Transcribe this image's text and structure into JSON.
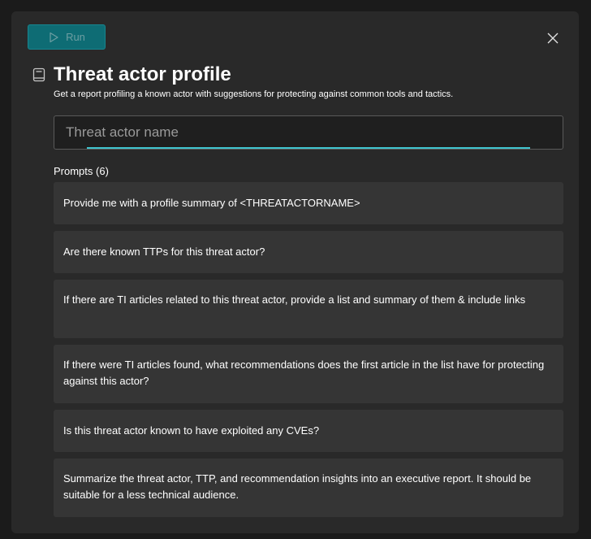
{
  "toolbar": {
    "run_label": "Run",
    "run_icon": "play-icon",
    "close_icon": "close-icon"
  },
  "header": {
    "icon": "book-icon",
    "title": "Threat actor profile",
    "subtitle": "Get a report profiling a known actor with suggestions for protecting against common tools and tactics."
  },
  "input": {
    "placeholder": "Threat actor name",
    "value": ""
  },
  "prompts": {
    "label": "Prompts (6)",
    "items": [
      {
        "text": "Provide me with a profile summary of <THREATACTORNAME>"
      },
      {
        "text": "Are there known TTPs for this threat actor?"
      },
      {
        "text": "If there are TI articles related to this threat actor, provide a list and summary of them & include links"
      },
      {
        "text": "If there were TI articles found, what recommendations does the first article in the list have for protecting against this actor?"
      },
      {
        "text": "Is this threat actor known to have exploited any CVEs?"
      },
      {
        "text": "Summarize the threat actor, TTP, and recommendation insights into an executive report. It should be suitable for a less technical audience."
      }
    ]
  },
  "colors": {
    "accent": "#0e6c74",
    "focus_underline": "#3fc5cf",
    "dialog_bg": "#292929",
    "card_bg": "#353535"
  }
}
